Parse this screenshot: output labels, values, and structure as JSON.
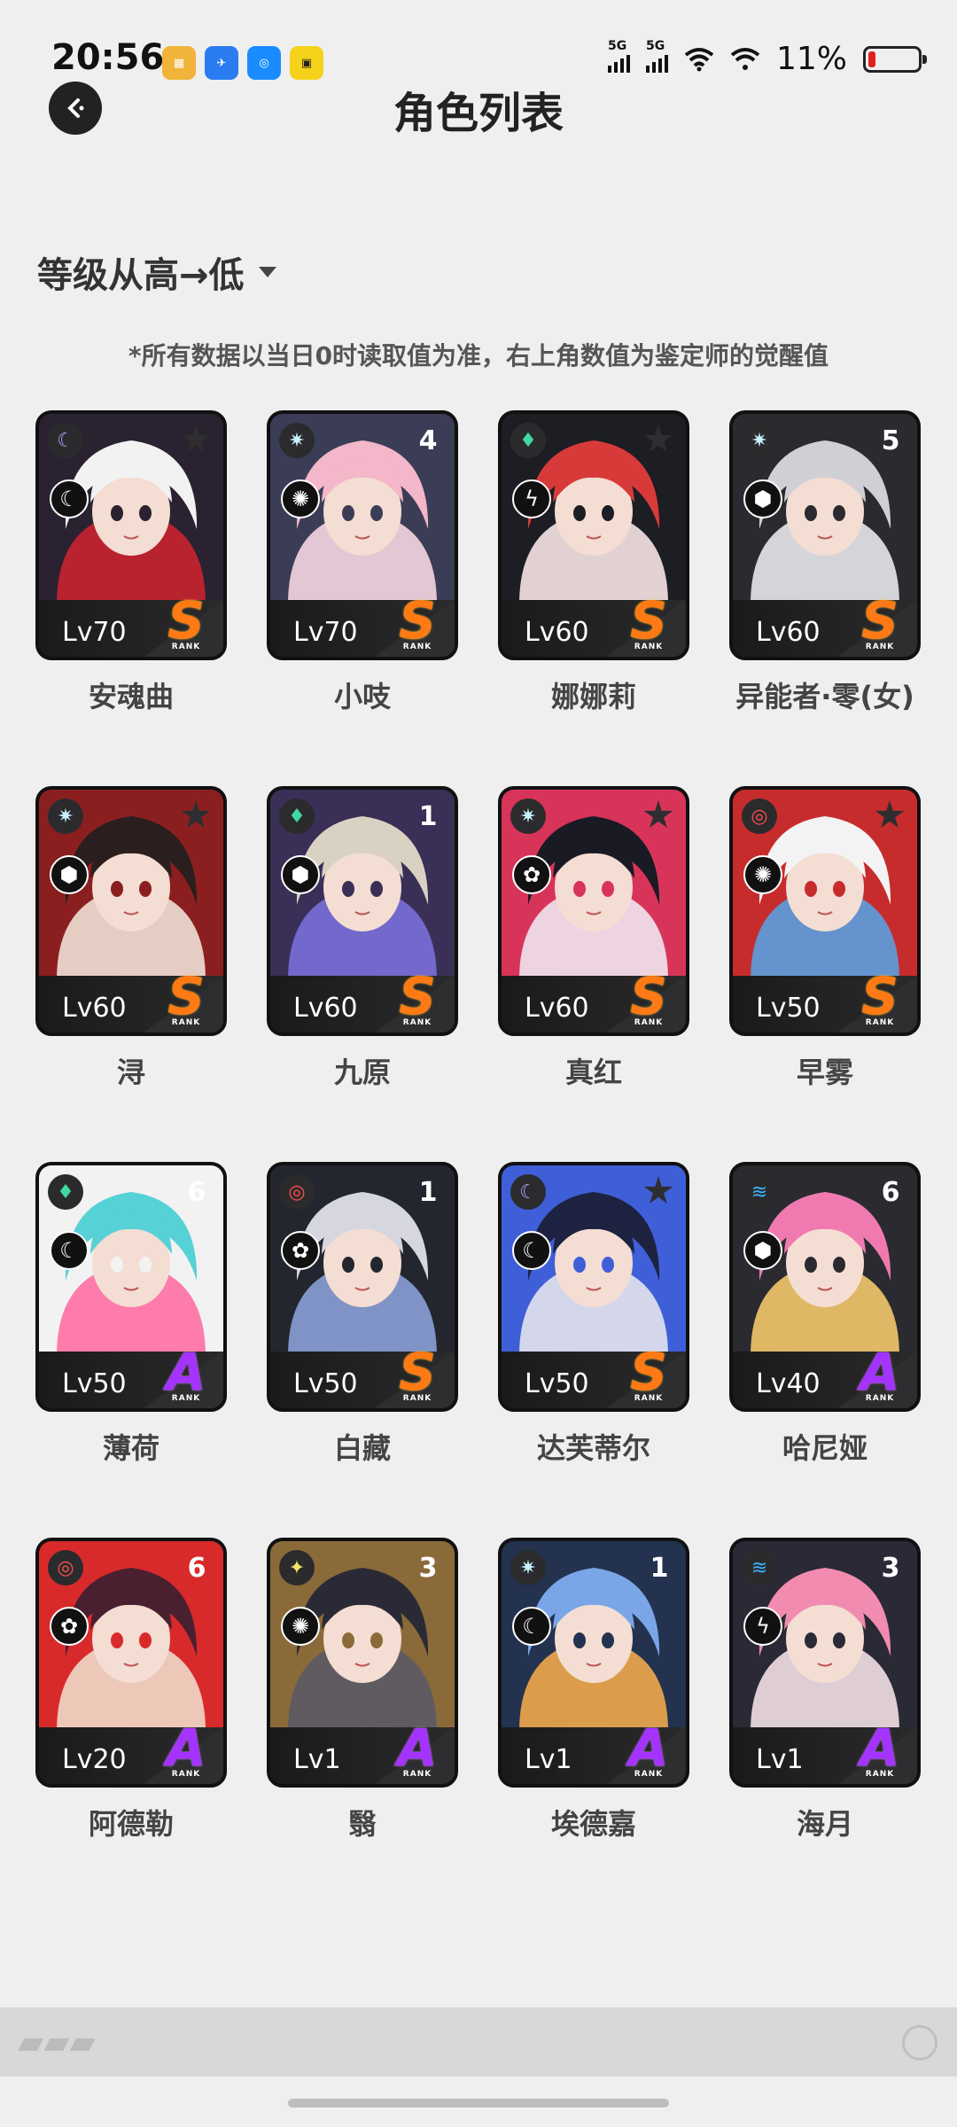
{
  "status_bar": {
    "time": "20:56",
    "network1": "5G",
    "network2": "5G",
    "battery": "11%"
  },
  "header": {
    "title": "角色列表"
  },
  "sort": {
    "label": "等级从高→低"
  },
  "notice": "*所有数据以当日0时读取值为准，右上角数值为鉴定师的觉醒值",
  "rank_caption": "RANK",
  "characters": [
    {
      "name": "安魂曲",
      "level": "Lv70",
      "rank": "S",
      "awakening": "",
      "element": "moon",
      "elem_color": "#b7a2ff",
      "role": "☾",
      "palette": [
        "#f2f2f2",
        "#2a2230",
        "#c92230"
      ]
    },
    {
      "name": "小吱",
      "level": "Lv70",
      "rank": "S",
      "awakening": "4",
      "element": "sun",
      "elem_color": "#c9f2ff",
      "role": "✺",
      "palette": [
        "#f3b7c9",
        "#3a3d55",
        "#f7d6e2"
      ]
    },
    {
      "name": "娜娜莉",
      "level": "Lv60",
      "rank": "S",
      "awakening": "",
      "element": "flame",
      "elem_color": "#40d9a0",
      "role": "ϟ",
      "palette": [
        "#d83a3a",
        "#1d1d24",
        "#f7e6e6"
      ]
    },
    {
      "name": "异能者·零(女)",
      "level": "Lv60",
      "rank": "S",
      "awakening": "5",
      "element": "sun",
      "elem_color": "#c9f2ff",
      "role": "⬢",
      "palette": [
        "#cfcfd4",
        "#2a2a30",
        "#e8e8ec"
      ]
    },
    {
      "name": "浔",
      "level": "Lv60",
      "rank": "S",
      "awakening": "",
      "element": "sun",
      "elem_color": "#c9f2ff",
      "role": "⬢",
      "palette": [
        "#2b1e1e",
        "#8b1f1f",
        "#f0e0d6"
      ]
    },
    {
      "name": "九原",
      "level": "Lv60",
      "rank": "S",
      "awakening": "1",
      "element": "flame",
      "elem_color": "#40d9a0",
      "role": "⬢",
      "palette": [
        "#d9d2c3",
        "#3a2f56",
        "#7a6fd8"
      ]
    },
    {
      "name": "真红",
      "level": "Lv60",
      "rank": "S",
      "awakening": "",
      "element": "sun",
      "elem_color": "#c9f2ff",
      "role": "✿",
      "palette": [
        "#1a1a24",
        "#d8345a",
        "#efe6ee"
      ]
    },
    {
      "name": "早雾",
      "level": "Lv50",
      "rank": "S",
      "awakening": "",
      "element": "target",
      "elem_color": "#ff4d4d",
      "role": "✺",
      "palette": [
        "#f3f3f3",
        "#c72c2c",
        "#5a9fe0"
      ]
    },
    {
      "name": "薄荷",
      "level": "Lv50",
      "rank": "A",
      "awakening": "6",
      "element": "flame",
      "elem_color": "#40d9a0",
      "role": "☾",
      "palette": [
        "#56d1d6",
        "#f2f2f2",
        "#ff6fa3"
      ]
    },
    {
      "name": "白藏",
      "level": "Lv50",
      "rank": "S",
      "awakening": "1",
      "element": "target",
      "elem_color": "#ff4d4d",
      "role": "✿",
      "palette": [
        "#d6d6de",
        "#23262f",
        "#8aa0d8"
      ]
    },
    {
      "name": "达芙蒂尔",
      "level": "Lv50",
      "rank": "S",
      "awakening": "",
      "element": "moon",
      "elem_color": "#b7a2ff",
      "role": "☾",
      "palette": [
        "#1c2240",
        "#3f5fd8",
        "#e4e4ee"
      ]
    },
    {
      "name": "哈尼娅",
      "level": "Lv40",
      "rank": "A",
      "awakening": "6",
      "element": "wave",
      "elem_color": "#3bb4ff",
      "role": "⬢",
      "palette": [
        "#f07ab0",
        "#2a2a30",
        "#f2c86a"
      ]
    },
    {
      "name": "阿德勒",
      "level": "Lv20",
      "rank": "A",
      "awakening": "6",
      "element": "target",
      "elem_color": "#ff4d4d",
      "role": "✿",
      "palette": [
        "#4a2030",
        "#d82a2a",
        "#f0d8c8"
      ]
    },
    {
      "name": "翳",
      "level": "Lv1",
      "rank": "A",
      "awakening": "3",
      "element": "star",
      "elem_color": "#f2e36a",
      "role": "✺",
      "palette": [
        "#2a2a36",
        "#8b6a3a",
        "#5a5a66"
      ]
    },
    {
      "name": "埃德嘉",
      "level": "Lv1",
      "rank": "A",
      "awakening": "1",
      "element": "sun",
      "elem_color": "#c9f2ff",
      "role": "☾",
      "palette": [
        "#7aa6e8",
        "#23324f",
        "#f0a84a"
      ]
    },
    {
      "name": "海月",
      "level": "Lv1",
      "rank": "A",
      "awakening": "3",
      "element": "wave",
      "elem_color": "#3bb4ff",
      "role": "ϟ",
      "palette": [
        "#f28bb0",
        "#2a2a36",
        "#f2e0e6"
      ]
    }
  ]
}
